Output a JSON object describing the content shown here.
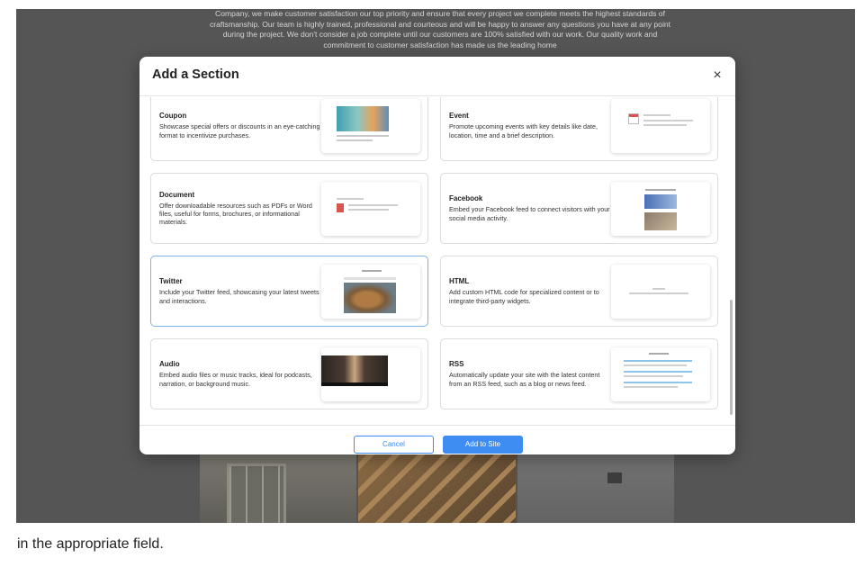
{
  "background": {
    "paragraph": "Company, we make customer satisfaction our top priority and ensure that every project we complete meets the highest standards of craftsmanship. Our team is highly trained, professional and courteous and will be happy to answer any questions you have at any point during the project. We don't consider a job complete until our customers are 100% satisfied with our work. Our quality work and commitment to customer satisfaction has made us the leading home"
  },
  "modal": {
    "title": "Add a Section",
    "close_glyph": "×",
    "sections": [
      {
        "title": "Coupon",
        "description": "Showcase special offers or discounts in an eye-catching format to incentivize purchases."
      },
      {
        "title": "Event",
        "description": "Promote upcoming events with key details like date, location, time and a brief description."
      },
      {
        "title": "Document",
        "description": "Offer downloadable resources such as PDFs or Word files, useful for forms, brochures, or informational materials."
      },
      {
        "title": "Facebook",
        "description": "Embed your Facebook feed to connect visitors with your social media activity."
      },
      {
        "title": "Twitter",
        "description": "Include your Twitter feed, showcasing your latest tweets and interactions."
      },
      {
        "title": "HTML",
        "description": "Add custom HTML code for specialized content or to integrate third-party widgets."
      },
      {
        "title": "Audio",
        "description": "Embed audio files or music tracks, ideal for podcasts, narration, or background music."
      },
      {
        "title": "RSS",
        "description": "Automatically update your site with the latest content from an RSS feed, such as a blog or news feed."
      }
    ],
    "selected_section": "Twitter",
    "cancel_label": "Cancel",
    "add_label": "Add to Site"
  },
  "caption": "in the appropriate field.",
  "colors": {
    "accent": "#3d8df2",
    "selected_border": "#7fb2ee",
    "overlay": "#555555"
  }
}
